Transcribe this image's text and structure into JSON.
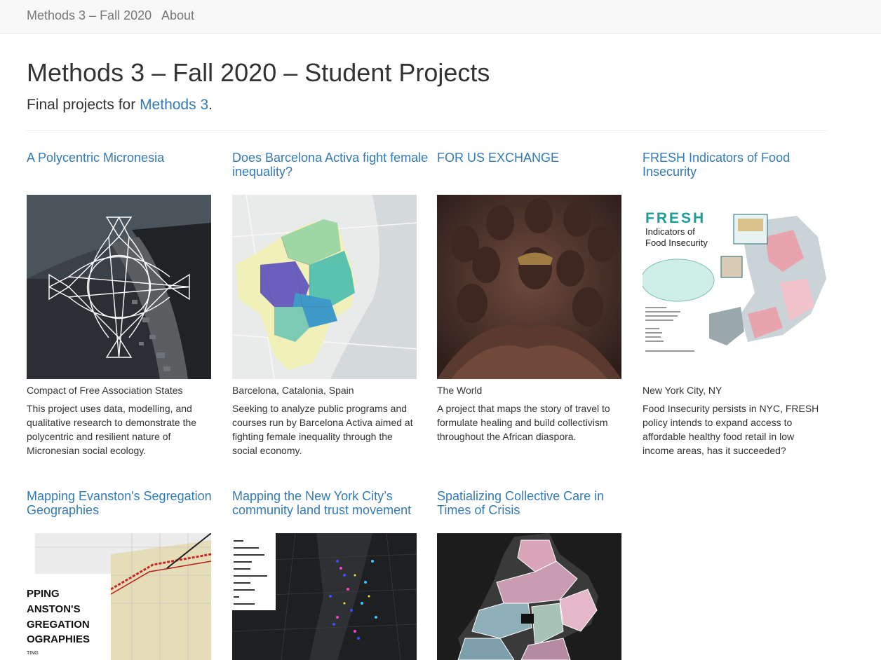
{
  "nav": {
    "brand": "Methods 3 – Fall 2020",
    "about": "About"
  },
  "header": {
    "title": "Methods 3 – Fall 2020 – Student Projects",
    "lead_prefix": "Final projects for ",
    "lead_link": "Methods 3",
    "lead_suffix": "."
  },
  "projects": [
    {
      "title": "A Polycentric Micronesia",
      "location": "Compact of Free Association States",
      "description": "This project uses data, modelling, and qualitative research to demonstrate the polycentric and resilient nature of Micronesian social ecology."
    },
    {
      "title": "Does Barcelona Activa fight female inequality?",
      "location": "Barcelona, Catalonia, Spain",
      "description": "Seeking to analyze public programs and courses run by Barcelona Activa aimed at fighting female inequality through the social economy."
    },
    {
      "title": "FOR US EXCHANGE",
      "location": "The World",
      "description": "A project that maps the story of travel to formulate healing and build collectivism throughout the African diaspora."
    },
    {
      "title": "FRESH Indicators of Food Insecurity",
      "location": "New York City, NY",
      "description": "Food Insecurity persists in NYC, FRESH policy intends to expand access to affordable healthy food retail in low income areas, has it succeeded?"
    },
    {
      "title": "Mapping Evanston's Segregation Geographies"
    },
    {
      "title": "Mapping the New York City’s community land trust movement"
    },
    {
      "title": "Spatializing Collective Care in Times of Crisis"
    }
  ],
  "thumb_text": {
    "fresh_brand": "FRESH",
    "fresh_line1": "Indicators of",
    "fresh_line2": "Food Insecurity",
    "evanston_l1": "PPING",
    "evanston_l2": "ANSTON'S",
    "evanston_l3": "GREGATION",
    "evanston_l4": "OGRAPHIES",
    "evanston_l5": "TING"
  },
  "colors": {
    "link": "#337ab7",
    "navbar_bg": "#f8f8f8",
    "nav_text": "#777777",
    "fresh_teal": "#1a9e96"
  }
}
